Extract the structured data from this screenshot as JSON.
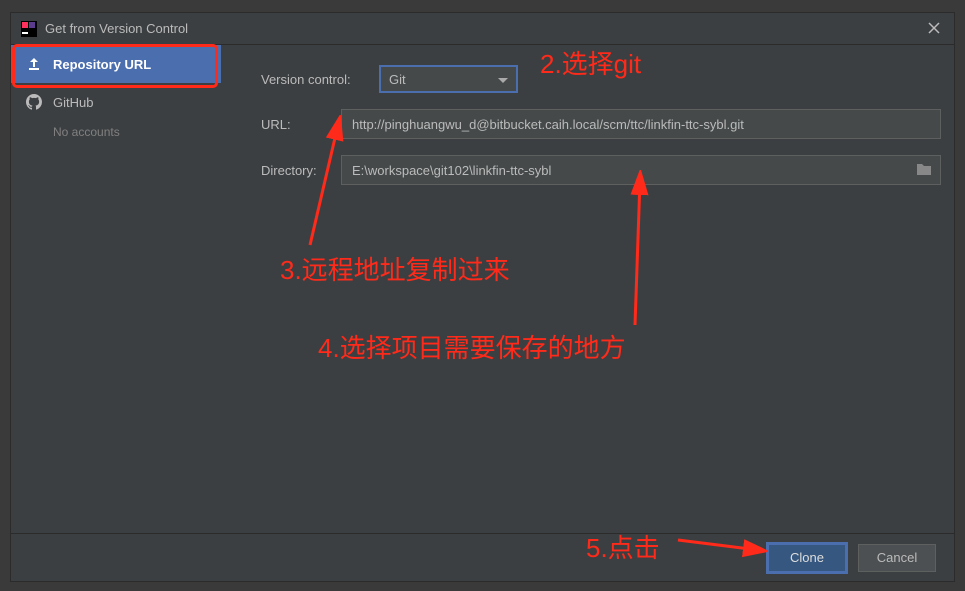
{
  "titlebar": {
    "title": "Get from Version Control"
  },
  "sidebar": {
    "items": [
      {
        "label": "Repository URL"
      },
      {
        "label": "GitHub",
        "sub": "No accounts"
      }
    ]
  },
  "form": {
    "version_control_label": "Version control:",
    "version_control_value": "Git",
    "url_label": "URL:",
    "url_value": "http://pinghuangwu_d@bitbucket.caih.local/scm/ttc/linkfin-ttc-sybl.git",
    "directory_label": "Directory:",
    "directory_value": "E:\\workspace\\git102\\linkfin-ttc-sybl"
  },
  "buttons": {
    "clone": "Clone",
    "cancel": "Cancel"
  },
  "annotations": {
    "a2": "2.选择git",
    "a3": "3.远程地址复制过来",
    "a4": "4.选择项目需要保存的地方",
    "a5": "5.点击"
  }
}
